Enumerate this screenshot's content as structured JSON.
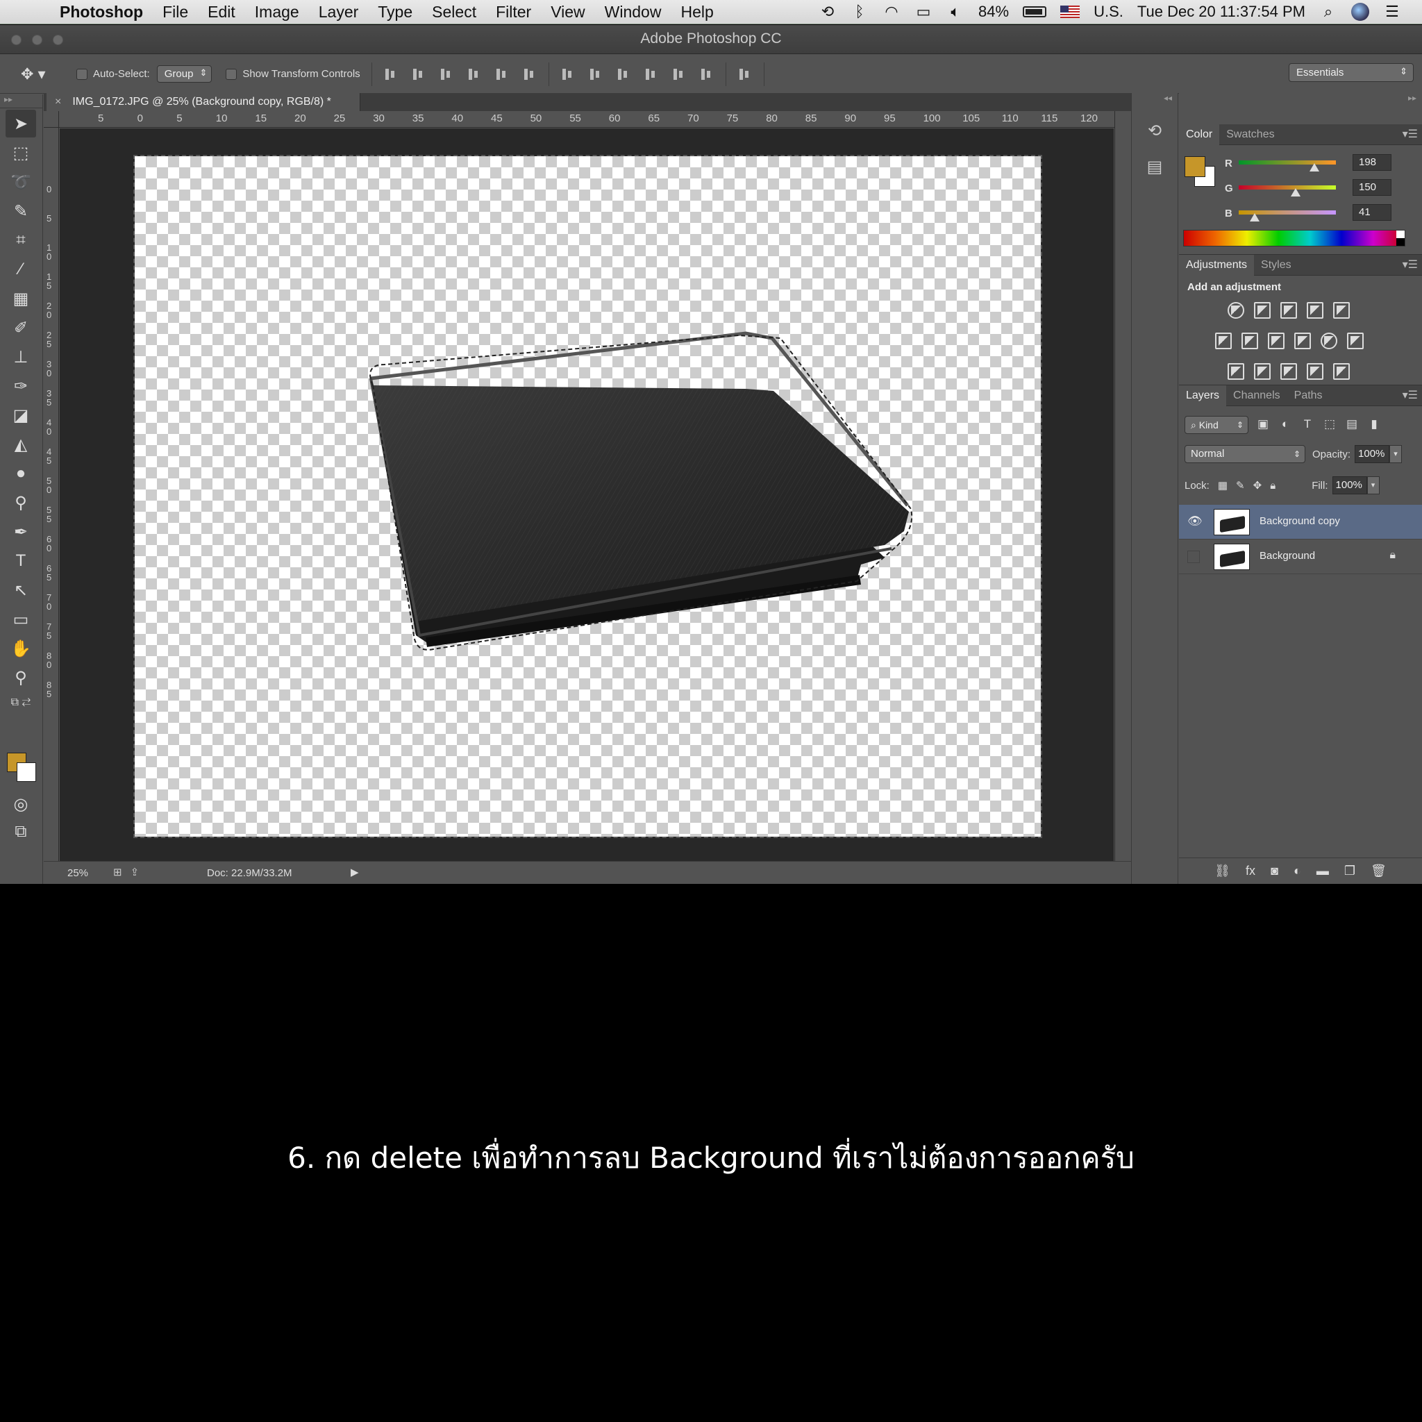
{
  "menubar": {
    "app_name": "Photoshop",
    "items": [
      "File",
      "Edit",
      "Image",
      "Layer",
      "Type",
      "Select",
      "Filter",
      "View",
      "Window",
      "Help"
    ],
    "battery": "84%",
    "input_source": "U.S.",
    "datetime": "Tue Dec 20  11:37:54 PM"
  },
  "window": {
    "title": "Adobe Photoshop CC"
  },
  "options_bar": {
    "auto_select_label": "Auto-Select:",
    "auto_select_value": "Group",
    "transform_label": "Show Transform Controls",
    "workspace": "Essentials"
  },
  "document": {
    "tab_title": "IMG_0172.JPG @ 25% (Background copy, RGB/8) *",
    "ruler_top_ticks": [
      "5",
      "0",
      "5",
      "10",
      "15",
      "20",
      "25",
      "30",
      "35",
      "40",
      "45",
      "50",
      "55",
      "60",
      "65",
      "70",
      "75",
      "80",
      "85",
      "90",
      "95",
      "100",
      "105",
      "110",
      "115",
      "120"
    ],
    "ruler_left_ticks": [
      "0",
      "5",
      "1 0",
      "1 5",
      "2 0",
      "2 5",
      "3 0",
      "3 5",
      "4 0",
      "4 5",
      "5 0",
      "5 5",
      "6 0",
      "6 5",
      "7 0",
      "7 5",
      "8 0",
      "8 5"
    ],
    "zoom": "25%",
    "doc_size": "Doc: 22.9M/33.2M"
  },
  "color_panel": {
    "tabs": [
      "Color",
      "Swatches"
    ],
    "foreground": "#c69629",
    "r": {
      "label": "R",
      "value": "198"
    },
    "g": {
      "label": "G",
      "value": "150"
    },
    "b": {
      "label": "B",
      "value": "41"
    }
  },
  "adjustments_panel": {
    "tabs": [
      "Adjustments",
      "Styles"
    ],
    "title": "Add an adjustment"
  },
  "layers_panel": {
    "tabs": [
      "Layers",
      "Channels",
      "Paths"
    ],
    "kind": "Kind",
    "blend_mode": "Normal",
    "opacity_label": "Opacity:",
    "opacity": "100%",
    "lock_label": "Lock:",
    "fill_label": "Fill:",
    "fill": "100%",
    "layers": [
      {
        "name": "Background copy",
        "visible": true,
        "selected": true
      },
      {
        "name": "Background",
        "visible": false,
        "locked": true
      }
    ]
  },
  "caption": "6. กด delete เพื่อทำการลบ Background ที่เราไม่ต้องการออกครับ"
}
